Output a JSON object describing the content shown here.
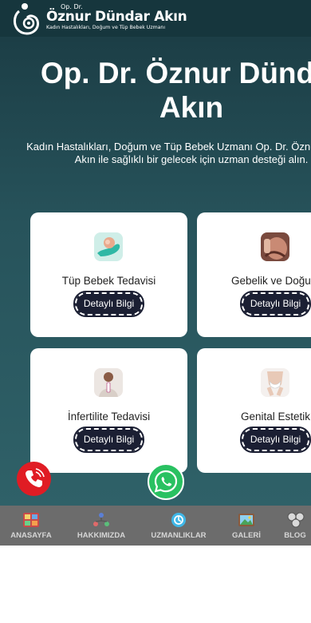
{
  "header": {
    "logo_small": "Op. Dr.",
    "logo_name": "Öznur Dündar Akın",
    "logo_tagline": "Kadın Hastalıkları, Doğum ve Tüp Bebek Uzmanı"
  },
  "hero": {
    "title_line1": "Op. Dr. Öznur Dündar",
    "title_line2": "Akın",
    "subtitle_line1": "Kadın Hastalıkları, Doğum ve Tüp Bebek Uzmanı Op. Dr. Öznur Dündar",
    "subtitle_line2": "Akın ile sağlıklı bir gelecek için uzman desteği alın."
  },
  "services": [
    {
      "title": "Tüp Bebek Tedavisi",
      "button": "Detaylı Bilgi",
      "icon": "embryo-icon"
    },
    {
      "title": "Gebelik ve Doğum",
      "button": "Detaylı Bilgi",
      "icon": "pregnancy-icon"
    },
    {
      "title": "İnfertilite Tedavisi",
      "button": "Detaylı Bilgi",
      "icon": "pregnancy-test-icon"
    },
    {
      "title": "Genital Estetik",
      "button": "Detaylı Bilgi",
      "icon": "genital-aesthetics-icon"
    }
  ],
  "floating": {
    "call_icon": "phone-icon",
    "whatsapp_icon": "whatsapp-icon",
    "call_color": "#e01c24",
    "whatsapp_color": "#29c161"
  },
  "nav": [
    {
      "label": "ANASAYFA",
      "icon": "home-icon"
    },
    {
      "label": "HAKKIMIZDA",
      "icon": "team-icon"
    },
    {
      "label": "UZMANLIKLAR",
      "icon": "expertise-icon"
    },
    {
      "label": "GALERİ",
      "icon": "gallery-icon"
    },
    {
      "label": "BLOG",
      "icon": "blog-icon"
    }
  ],
  "colors": {
    "header_bg": "#16363d",
    "hero_bg": "#27535b",
    "button_bg": "#1b1f33",
    "nav_bg": "#6c6c6c"
  }
}
